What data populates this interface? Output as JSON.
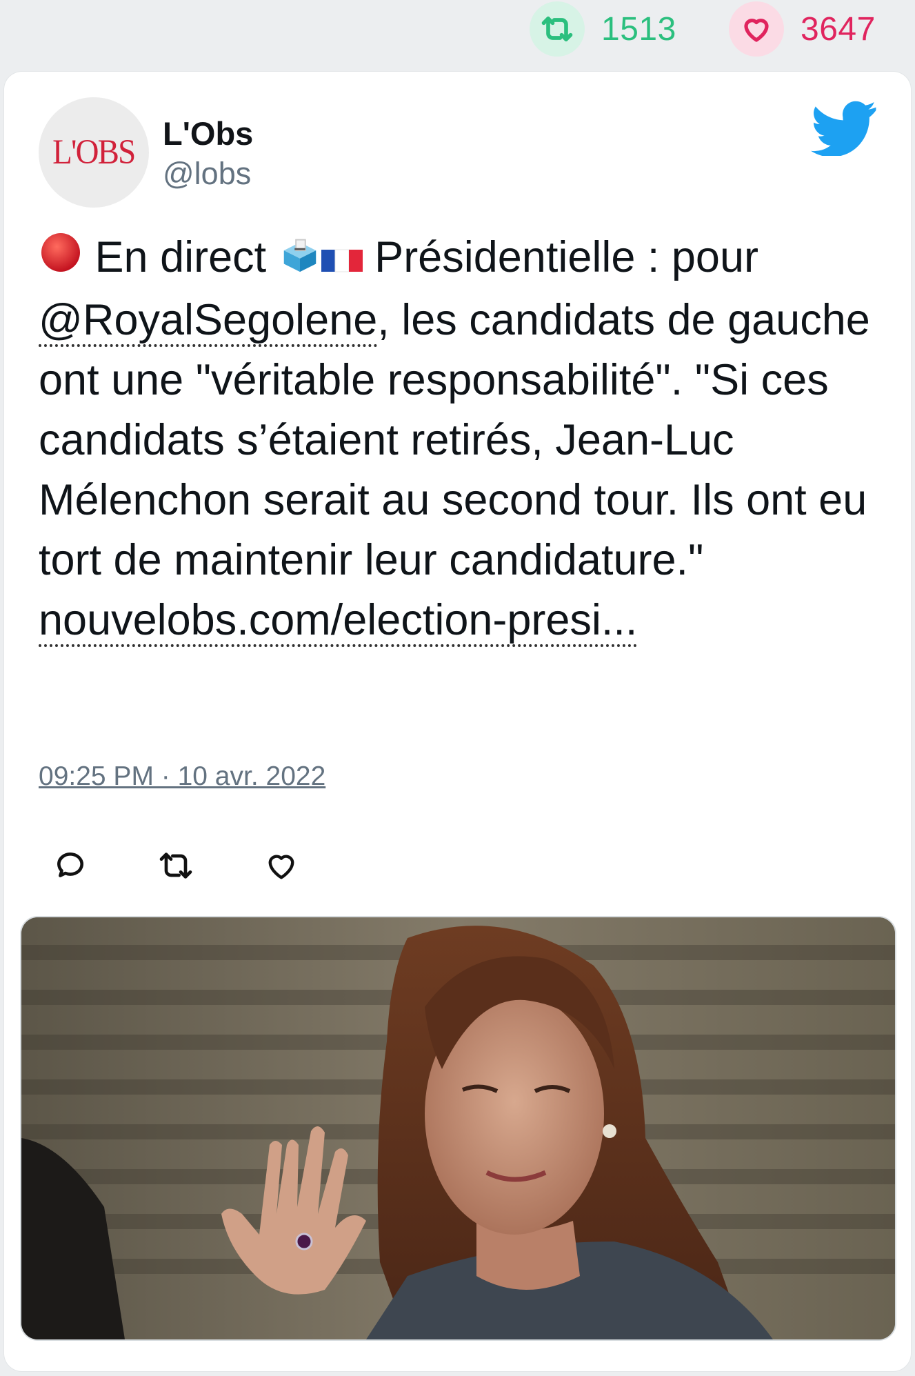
{
  "stats": {
    "retweet_count": "1513",
    "like_count": "3647",
    "retweet_icon": "retweet-icon",
    "like_icon": "heart-icon",
    "retweet_color": "#2bbf7e",
    "like_color": "#e0245e"
  },
  "tweet": {
    "author_name": "L'Obs",
    "author_handle": "@lobs",
    "avatar_logo": "L'OBS",
    "text_segments": {
      "live": "En direct",
      "headline": "Présidentielle : pour",
      "mention": "@RoyalSegolene",
      "body": ", les candidats de gauche ont une \"véritable responsabilité\". \"Si ces candidats s’étaient retirés, Jean-Luc Mélenchon serait au second tour. Ils ont eu tort de maintenir leur candidature.\"",
      "link": "nouvelobs.com/election-presi..."
    },
    "timestamp": "09:25 PM · 10 avr. 2022",
    "brand_color": "#1da1f2"
  },
  "actions": [
    {
      "icon": "reply-icon"
    },
    {
      "icon": "retweet-icon"
    },
    {
      "icon": "like-icon"
    }
  ]
}
